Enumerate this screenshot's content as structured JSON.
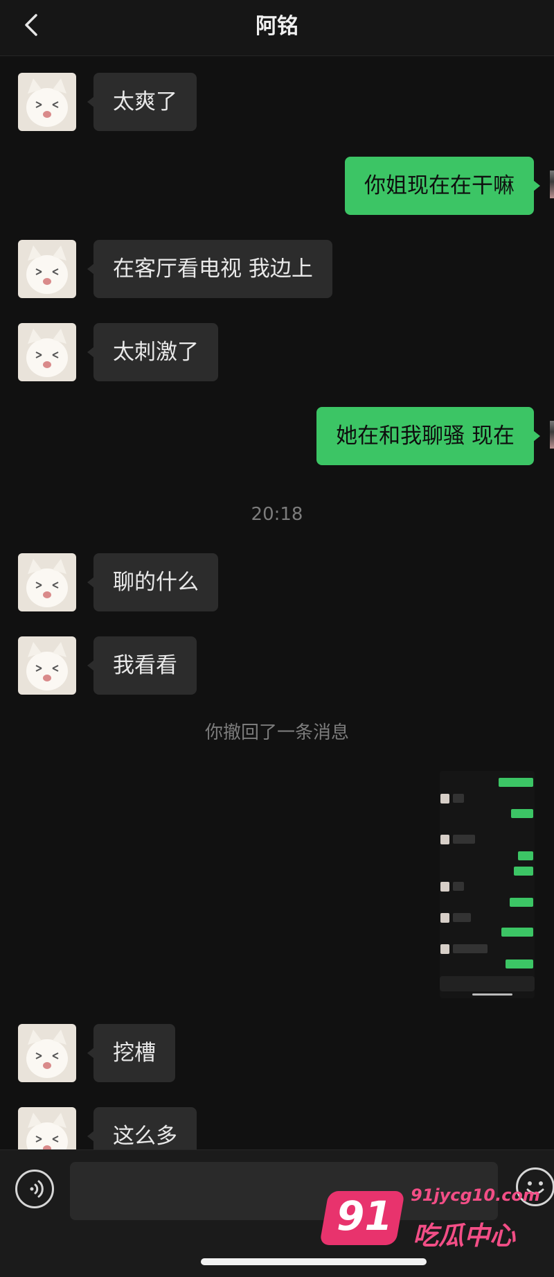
{
  "header": {
    "title": "阿铭",
    "back_icon": "chevron-left-icon"
  },
  "messages": [
    {
      "side": "in",
      "text": "太爽了"
    },
    {
      "side": "out",
      "text": "你姐现在在干嘛"
    },
    {
      "side": "in",
      "text": "在客厅看电视 我边上"
    },
    {
      "side": "in",
      "text": "太刺激了"
    },
    {
      "side": "out",
      "text": "她在和我聊骚 现在"
    },
    {
      "side": "in",
      "text": "聊的什么"
    },
    {
      "side": "in",
      "text": "我看看"
    },
    {
      "side": "in",
      "text": "挖槽"
    },
    {
      "side": "in",
      "text": "这么多"
    }
  ],
  "system": {
    "timestamp": "20:18",
    "recalled_notice": "你撤回了一条消息"
  },
  "image_message": {
    "kind": "chat screenshot"
  },
  "bottom_bar": {
    "voice_icon": "voice-icon",
    "emoji_icon": "emoji-icon",
    "input_value": ""
  },
  "watermark": {
    "number": "91",
    "url": "91jycg10.com",
    "name": "吃瓜中心"
  },
  "colors": {
    "background": "#111111",
    "incoming_bubble": "#2c2c2c",
    "outgoing_bubble": "#3cc565",
    "watermark_pink": "#e8336d"
  }
}
